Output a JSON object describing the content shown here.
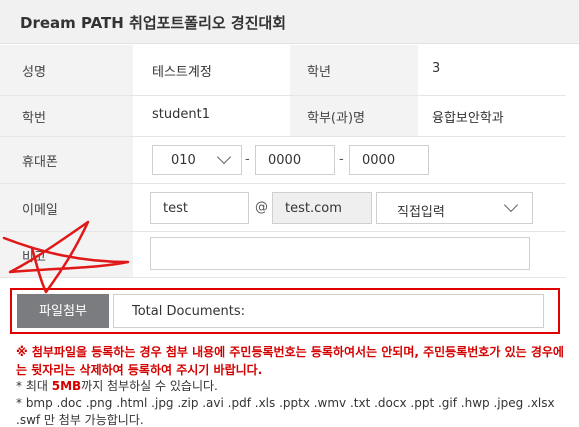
{
  "header": {
    "title": "Dream PATH 취업포트폴리오 경진대회"
  },
  "form": {
    "name_label": "성명",
    "name_value": "테스트계정",
    "grade_label": "학년",
    "grade_value": "3",
    "student_id_label": "학번",
    "student_id_value": "student1",
    "dept_label": "학부(과)명",
    "dept_value": "융합보안학과",
    "phone_label": "휴대폰",
    "phone_prefix": "010",
    "phone_dash": "-",
    "phone_mid": "0000",
    "phone_last": "0000",
    "email_label": "이메일",
    "email_id": "test",
    "email_at": "@",
    "email_domain": "test.com",
    "email_select": "직접입력",
    "memo_label": "비고",
    "memo_value": ""
  },
  "file": {
    "attach_label": "파일첨부",
    "documents_label": "Total Documents:"
  },
  "notice": {
    "warning": "※ 첨부파일을 등록하는 경우 첨부 내용에 주민등록번호는 등록하여서는 안되며, 주민등록번호가 있는 경우에는 뒷자리는 삭제하여 등록하여 주시기 바랍니다.",
    "max_prefix": "* 최대 ",
    "max_size": "5MB",
    "max_suffix": "까지 첨부하실 수 있습니다.",
    "extensions": "* bmp .doc .png .html .jpg .zip .avi .pdf .xls .pptx .wmv .txt .docx .ppt .gif .hwp .jpeg .xlsx .swf 만 첨부 가능합니다."
  },
  "colors": {
    "accent_red": "#d40000",
    "button_gray": "#7b7c80",
    "label_bg": "#f3f3f3"
  }
}
